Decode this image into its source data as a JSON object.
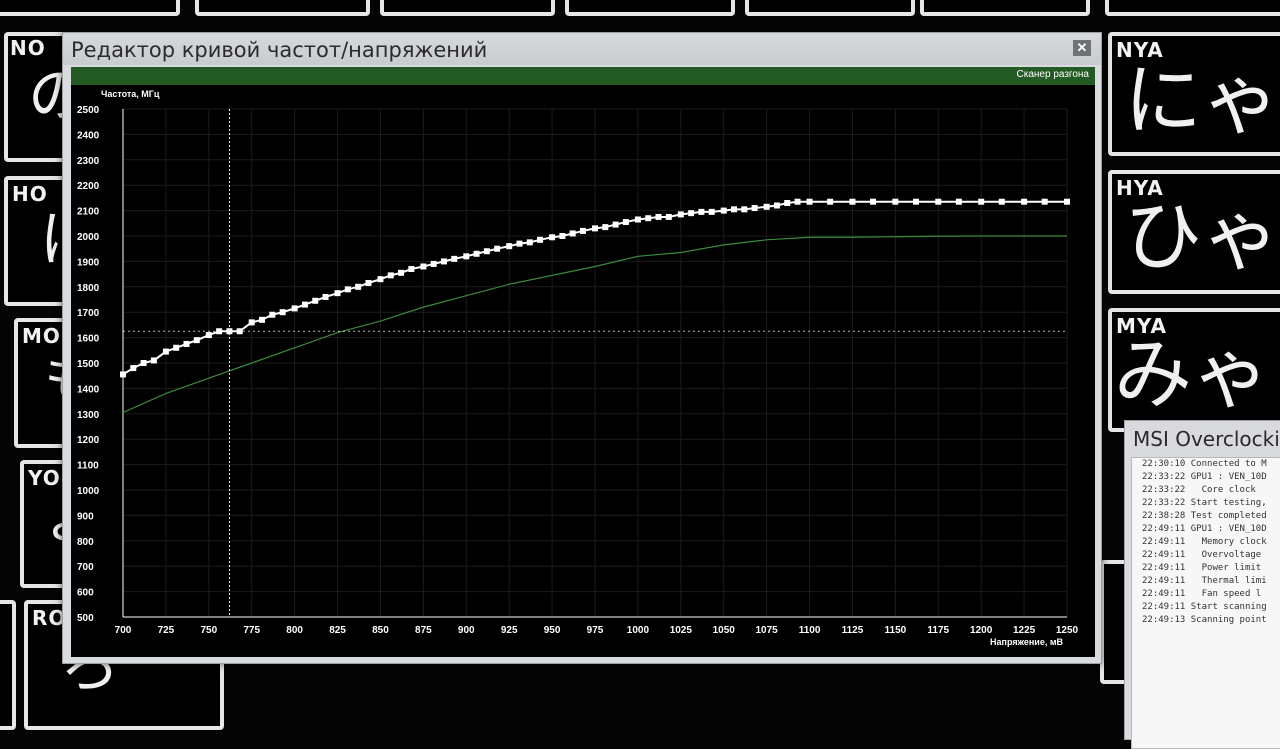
{
  "background": {
    "left_labels": [
      "NO",
      "HO",
      "MO",
      "YO",
      "RO"
    ],
    "right_labels": [
      "NYA",
      "HYA",
      "MYA"
    ],
    "right_kana": [
      "にゃ",
      "ひゃ",
      "みゃ"
    ],
    "left_kana": [
      "の",
      "ほ",
      "も",
      "よ",
      "ろ"
    ]
  },
  "editor": {
    "title": "Редактор кривой частот/напряжений",
    "close_label": "✕",
    "scanner_label": "Сканер разгона"
  },
  "chart_data": {
    "type": "line",
    "ylabel": "Частота, МГц",
    "xlabel": "Напряжение, мВ",
    "xlim": [
      700,
      1250
    ],
    "ylim": [
      500,
      2500
    ],
    "x_ticks": [
      700,
      725,
      750,
      775,
      800,
      825,
      850,
      875,
      900,
      925,
      950,
      975,
      1000,
      1025,
      1050,
      1075,
      1100,
      1125,
      1150,
      1175,
      1200,
      1225,
      1250
    ],
    "y_ticks": [
      500,
      600,
      700,
      800,
      900,
      1000,
      1100,
      1200,
      1300,
      1400,
      1500,
      1600,
      1700,
      1800,
      1900,
      2000,
      2100,
      2200,
      2300,
      2400,
      2500
    ],
    "cursor_voltage": 762,
    "cursor_frequency": 1625,
    "series": [
      {
        "color": "#ffffff",
        "x": [
          700,
          706,
          712,
          718,
          725,
          731,
          737,
          743,
          750,
          756,
          762,
          768,
          775,
          781,
          787,
          793,
          800,
          806,
          812,
          818,
          825,
          831,
          837,
          843,
          850,
          856,
          862,
          868,
          875,
          881,
          887,
          893,
          900,
          906,
          912,
          918,
          925,
          931,
          937,
          943,
          950,
          956,
          962,
          968,
          975,
          981,
          987,
          993,
          1000,
          1006,
          1012,
          1018,
          1025,
          1031,
          1037,
          1043,
          1050,
          1056,
          1062,
          1068,
          1075,
          1081,
          1087,
          1093,
          1100,
          1112,
          1125,
          1137,
          1150,
          1162,
          1175,
          1187,
          1200,
          1212,
          1225,
          1237,
          1250
        ],
        "values": [
          1455,
          1480,
          1500,
          1510,
          1545,
          1560,
          1575,
          1590,
          1610,
          1625,
          1625,
          1625,
          1660,
          1670,
          1690,
          1700,
          1715,
          1730,
          1745,
          1760,
          1775,
          1790,
          1800,
          1815,
          1830,
          1845,
          1855,
          1870,
          1880,
          1890,
          1900,
          1910,
          1920,
          1930,
          1940,
          1950,
          1960,
          1970,
          1975,
          1985,
          1995,
          2000,
          2010,
          2020,
          2030,
          2035,
          2045,
          2055,
          2065,
          2070,
          2075,
          2075,
          2085,
          2090,
          2095,
          2095,
          2100,
          2105,
          2105,
          2110,
          2115,
          2120,
          2130,
          2135,
          2135,
          2135,
          2135,
          2135,
          2135,
          2135,
          2135,
          2135,
          2135,
          2135,
          2135,
          2135,
          2135
        ]
      },
      {
        "color": "#3a8a3a",
        "x": [
          700,
          725,
          750,
          775,
          800,
          825,
          850,
          875,
          900,
          925,
          950,
          975,
          1000,
          1025,
          1050,
          1075,
          1100,
          1125,
          1150,
          1175,
          1200,
          1225,
          1250
        ],
        "values": [
          1305,
          1380,
          1440,
          1500,
          1560,
          1620,
          1665,
          1720,
          1765,
          1810,
          1845,
          1880,
          1920,
          1935,
          1965,
          1985,
          1995,
          1995,
          1997,
          1999,
          2000,
          2000,
          2000
        ]
      },
      {
        "color": "#ffffff",
        "dashed": true,
        "x": [
          700,
          1250
        ],
        "values": [
          1625,
          1625
        ]
      }
    ]
  },
  "msi": {
    "title": "MSI Overclocki",
    "log_lines": [
      "22:30:10 Connected to M",
      "22:33:22 GPU1 : VEN_10D",
      "22:33:22   Core clock",
      "22:33:22 Start testing,",
      "22:38:28 Test completed",
      "22:49:11 GPU1 : VEN_10D",
      "22:49:11   Memory clock",
      "22:49:11   Overvoltage",
      "22:49:11   Power limit",
      "22:49:11   Thermal limi",
      "22:49:11   Fan speed l",
      "22:49:11 Start scanning",
      "22:49:13 Scanning point"
    ]
  }
}
